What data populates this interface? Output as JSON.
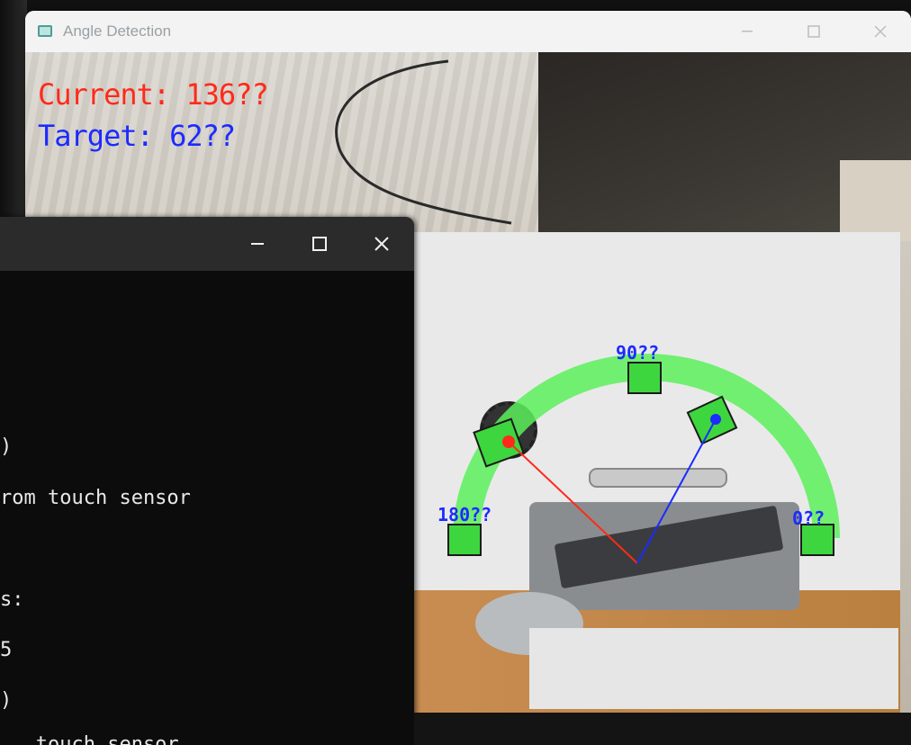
{
  "window": {
    "title": "Angle Detection"
  },
  "overlay": {
    "current_label": "Current: 136??",
    "target_label": "Target: 62??",
    "marker_labels": {
      "top": "90??",
      "left": "180??",
      "right": "0??"
    },
    "colors": {
      "current": "#ff2a1a",
      "target": "#1c2bff",
      "arc": "#5cf05c"
    }
  },
  "console": {
    "lines": [
      ")",
      "rom touch sensor",
      "",
      "s:",
      "5",
      ")",
      "   touch sensor"
    ]
  }
}
